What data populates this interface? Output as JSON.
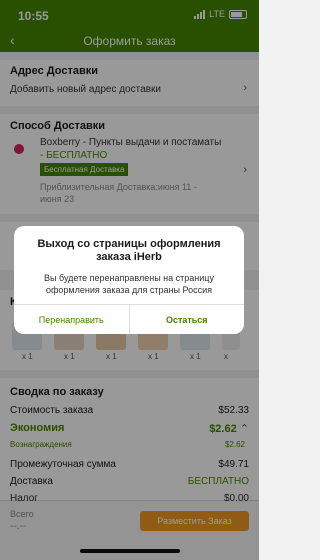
{
  "status": {
    "time": "10:55",
    "network": "LTE"
  },
  "nav": {
    "title": "Оформить заказ",
    "back_glyph": "‹"
  },
  "address": {
    "heading": "Адрес Доставки",
    "add_label": "Добавить новый адрес доставки"
  },
  "shipping": {
    "heading": "Способ Доставки",
    "method_name": "Boxberry - Пункты выдачи и постаматы",
    "method_price": "- БЕСПЛАТНО",
    "badge": "Бесплатная Доставка",
    "eta": "Приблизительная Доставка:июня 11 - июня 23"
  },
  "items": {
    "heading_prefix": "К",
    "quantities": [
      "x 1",
      "x 1",
      "x 1",
      "x 1",
      "x 1",
      "x"
    ]
  },
  "summary": {
    "heading": "Сводка по заказу",
    "order_cost_label": "Стоимость заказа",
    "order_cost": "$52.33",
    "savings_label": "Экономия",
    "savings": "$2.62",
    "rewards_label": "Вознаграждения",
    "rewards": "$2.62",
    "subtotal_label": "Промежуточная сумма",
    "subtotal": "$49.71",
    "delivery_label": "Доставка",
    "delivery": "БЕСПЛАТНО",
    "tax_label": "Налог",
    "tax": "$0.00"
  },
  "footer": {
    "total_label": "Всего",
    "total": "--.--",
    "place_order": "Разместить Заказ"
  },
  "dialog": {
    "title": "Выход со страницы оформления заказа iHerb",
    "message": "Вы будете перенаправлены на страницу оформления заказа для страны Россия",
    "redirect": "Перенаправить",
    "stay": "Остаться"
  },
  "colors": {
    "brand_green": "#458500",
    "accent_orange": "#f19a24"
  }
}
